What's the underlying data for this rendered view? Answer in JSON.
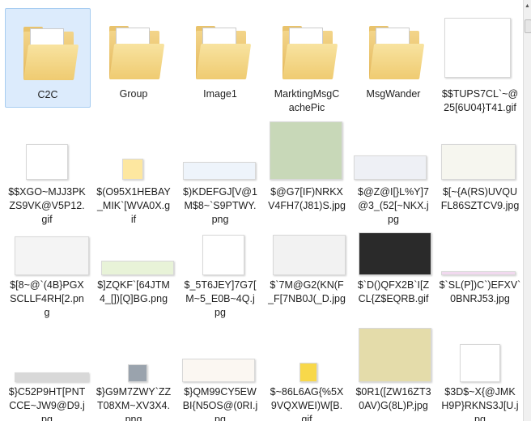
{
  "items": [
    {
      "type": "folder",
      "lines": [
        "C2C"
      ],
      "selected": true
    },
    {
      "type": "folder",
      "lines": [
        "Group"
      ]
    },
    {
      "type": "folder",
      "lines": [
        "Image1"
      ]
    },
    {
      "type": "folder",
      "lines": [
        "MarktingMsgC",
        "achePic"
      ]
    },
    {
      "type": "folder",
      "lines": [
        "MsgWander"
      ]
    },
    {
      "type": "image",
      "lines": [
        "$$TUPS7CL`~@",
        "25[6U04}T41.gif"
      ]
    },
    {
      "type": "image",
      "lines": [
        "$$XGO~MJJ3PK",
        "ZS9VK@V5P12.",
        "gif"
      ]
    },
    {
      "type": "image",
      "lines": [
        "$(O95X1HEBAY",
        "_MIK`[WVA0X.g",
        "if"
      ]
    },
    {
      "type": "image",
      "lines": [
        "$)KDEFGJ[V@1",
        "M$8~`S9PTWY.",
        "png"
      ]
    },
    {
      "type": "image",
      "lines": [
        "$@G7[IF)NRKX",
        "V4FH7(J81)S.jpg"
      ]
    },
    {
      "type": "image",
      "lines": [
        "$@Z@I[}L%Y]7",
        "@3_(52[~NKX.j",
        "pg"
      ]
    },
    {
      "type": "image",
      "lines": [
        "$[~{A(RS)UVQU",
        "FL86SZTCV9.jpg"
      ]
    },
    {
      "type": "image",
      "lines": [
        "$[8~@`(4B}PGX",
        "SCLLF4RH[2.pn",
        "g"
      ]
    },
    {
      "type": "image",
      "lines": [
        "$]ZQKF`[64JTM",
        "4_[])[Q]BG.png"
      ]
    },
    {
      "type": "image",
      "lines": [
        "$_5T6JEY]7G7[",
        "M~5_E0B~4Q.j",
        "pg"
      ]
    },
    {
      "type": "image",
      "lines": [
        "$`7M@G2(KN(F",
        "_F[7NB0J(_D.jpg"
      ]
    },
    {
      "type": "image",
      "lines": [
        "$`D()QFX2B`I[Z",
        "CL{Z$EQRB.gif"
      ]
    },
    {
      "type": "image",
      "lines": [
        "$`SL(P])C`)EFXV`",
        "0BNRJ53.jpg"
      ]
    },
    {
      "type": "image",
      "lines": [
        "$}C52P9HT[PNT",
        "CCE~JW9@D9.j",
        "pg"
      ]
    },
    {
      "type": "image",
      "lines": [
        "$}G9M7ZWY`ZZ",
        "T08XM~XV3X4.",
        "png"
      ]
    },
    {
      "type": "image",
      "lines": [
        "$}QM99CY5EW",
        "BI{N5OS@(0RI.j",
        "pg"
      ]
    },
    {
      "type": "image",
      "lines": [
        "$~86L6AG{%5X",
        "9VQXWEI)W[B.",
        "gif"
      ]
    },
    {
      "type": "image",
      "lines": [
        "$0R1([ZW16ZT3",
        "0AV)G(8L)P.jpg"
      ]
    },
    {
      "type": "image",
      "lines": [
        "$3D$~X{@JMK",
        "H9P}RKNS3J[U.j",
        "pg"
      ]
    }
  ]
}
